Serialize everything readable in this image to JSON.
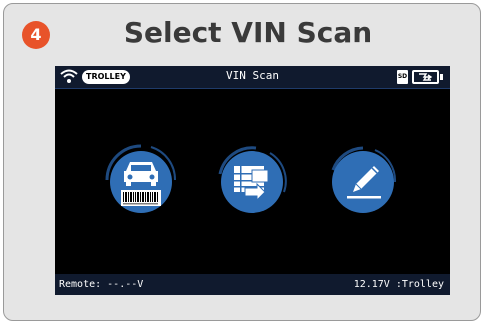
{
  "step": {
    "number": "4",
    "title": "Select VIN Scan"
  },
  "device": {
    "status_bar": {
      "mode_badge": "TROLLEY",
      "screen_title": "VIN Scan",
      "sd_label": "SD",
      "icons": [
        "wifi-icon",
        "sd-card-icon",
        "battery-charging-icon"
      ]
    },
    "buttons": [
      {
        "name": "vin-barcode-scan-button",
        "icon": "car-barcode-icon"
      },
      {
        "name": "vin-list-select-button",
        "icon": "list-select-icon"
      },
      {
        "name": "manual-entry-button",
        "icon": "pencil-icon"
      }
    ],
    "footer": {
      "remote_label": "Remote: --.--V",
      "voltage_label": "12.17V :Trolley"
    }
  },
  "colors": {
    "badge": "#e8532a",
    "title_text": "#3a3a3a",
    "button_fill": "#2f6eb5",
    "button_ring": "#1e4a80",
    "bar_bg": "#101a2e"
  }
}
